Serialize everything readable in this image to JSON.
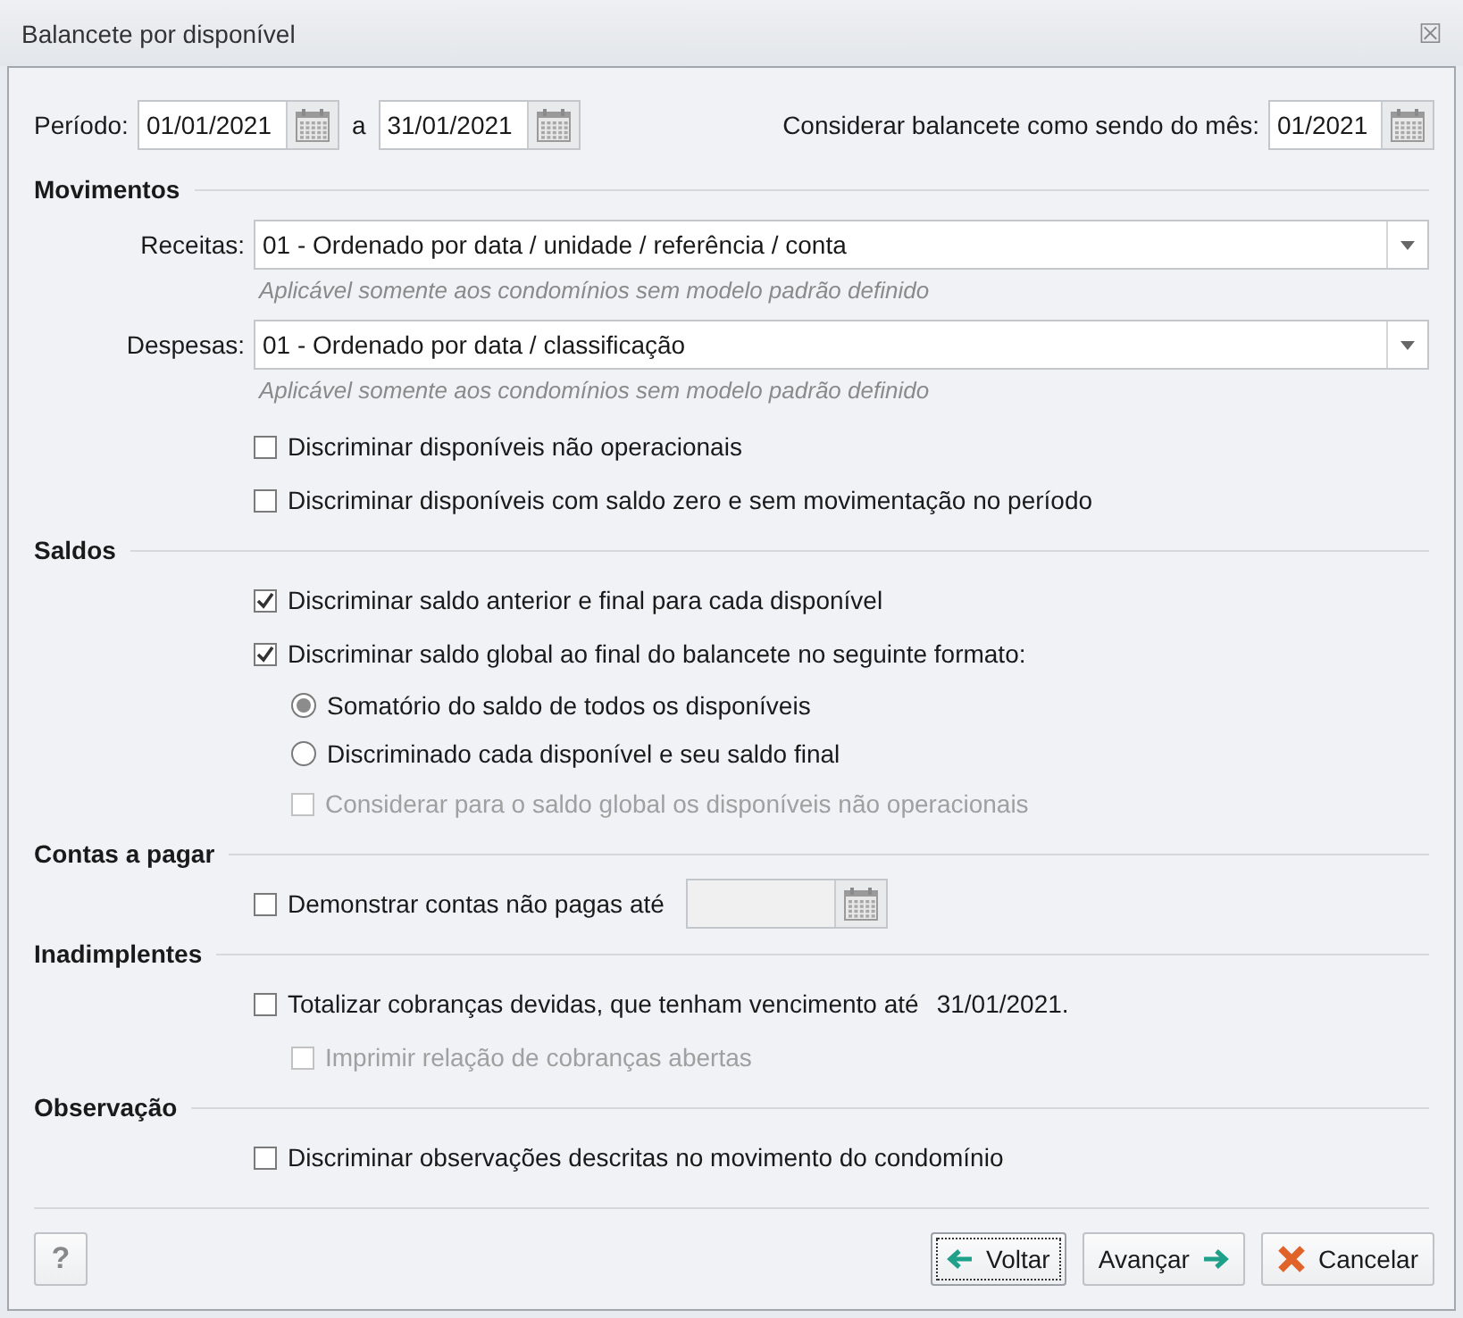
{
  "window": {
    "title": "Balancete por disponível",
    "close": "☒"
  },
  "period": {
    "label": "Período:",
    "start": "01/01/2021",
    "separator": "a",
    "end": "31/01/2021"
  },
  "month": {
    "label": "Considerar balancete como sendo do mês:",
    "value": "01/2021"
  },
  "sections": [
    {
      "title": "Movimentos",
      "items": [
        {
          "kind": "combo",
          "label": "Receitas:",
          "value": "01 - Ordenado por data / unidade / referência / conta",
          "hint": "Aplicável somente aos condomínios sem modelo padrão definido"
        },
        {
          "kind": "combo",
          "label": "Despesas:",
          "value": "01 - Ordenado por data / classificação",
          "hint": "Aplicável somente aos condomínios sem modelo padrão definido"
        },
        {
          "kind": "checkbox",
          "label": "Discriminar disponíveis não operacionais",
          "checked": false,
          "disabled": false
        },
        {
          "kind": "checkbox",
          "label": "Discriminar disponíveis com saldo zero e sem movimentação no período",
          "checked": false,
          "disabled": false
        }
      ]
    },
    {
      "title": "Saldos",
      "items": [
        {
          "kind": "checkbox",
          "label": "Discriminar saldo anterior e final para cada disponível",
          "checked": true,
          "disabled": false
        },
        {
          "kind": "checkbox",
          "label": "Discriminar saldo global ao final do balancete no seguinte formato:",
          "checked": true,
          "disabled": false,
          "children": [
            {
              "kind": "radio",
              "label": "Somatório do saldo de todos os disponíveis",
              "selected": true,
              "disabled": false
            },
            {
              "kind": "radio",
              "label": "Discriminado cada disponível e seu saldo final",
              "selected": false,
              "disabled": false
            },
            {
              "kind": "checkbox",
              "label": "Considerar para o saldo global os disponíveis não operacionais",
              "checked": false,
              "disabled": true
            }
          ]
        }
      ]
    },
    {
      "title": "Contas a pagar",
      "items": [
        {
          "kind": "checkbox_date",
          "label": "Demonstrar contas não pagas até",
          "checked": false,
          "disabled": false
        }
      ]
    },
    {
      "title": "Inadimplentes",
      "items": [
        {
          "kind": "checkbox",
          "label": "Totalizar cobranças devidas, que tenham vencimento até",
          "suffix": "31/01/2021.",
          "checked": false,
          "disabled": false,
          "children": [
            {
              "kind": "checkbox",
              "label": "Imprimir relação de cobranças abertas",
              "checked": false,
              "disabled": true
            }
          ]
        }
      ]
    },
    {
      "title": "Observação",
      "items": [
        {
          "kind": "checkbox",
          "label": "Discriminar observações descritas no movimento do condomínio",
          "checked": false,
          "disabled": false
        }
      ]
    }
  ],
  "help_button": "?",
  "buttons": [
    {
      "kind": "back",
      "label": "Voltar",
      "focused": true
    },
    {
      "kind": "next",
      "label": "Avançar",
      "focused": false
    },
    {
      "kind": "cancel",
      "label": "Cancelar",
      "focused": false
    }
  ]
}
